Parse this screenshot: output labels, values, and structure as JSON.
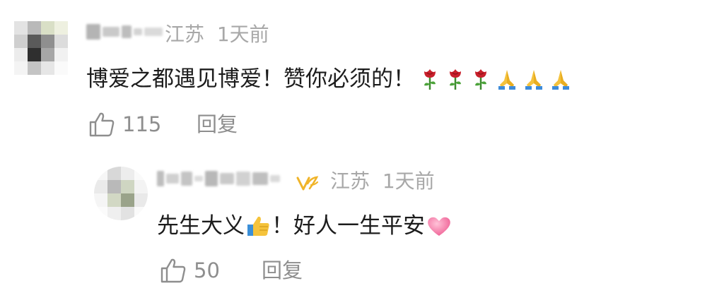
{
  "comment": {
    "location": "江苏",
    "time": "1天前",
    "text": "博爱之都遇见博爱！赞你必须的！",
    "emojis": [
      "rose-icon",
      "rose-icon",
      "rose-icon",
      "pray-icon",
      "pray-icon",
      "pray-icon"
    ],
    "likes": "115",
    "reply_label": "回复"
  },
  "reply": {
    "location": "江苏",
    "time": "1天前",
    "text_before": "先生大义",
    "text_middle": "！好人一生平安",
    "emojis": [
      "thumbs-up-icon",
      "heart-icon"
    ],
    "likes": "50",
    "reply_label": "回复"
  },
  "colors": {
    "meta": "#a8a8a8",
    "text": "#1c1c1c",
    "action": "#8e8e8e",
    "badge": "#f0b429"
  }
}
